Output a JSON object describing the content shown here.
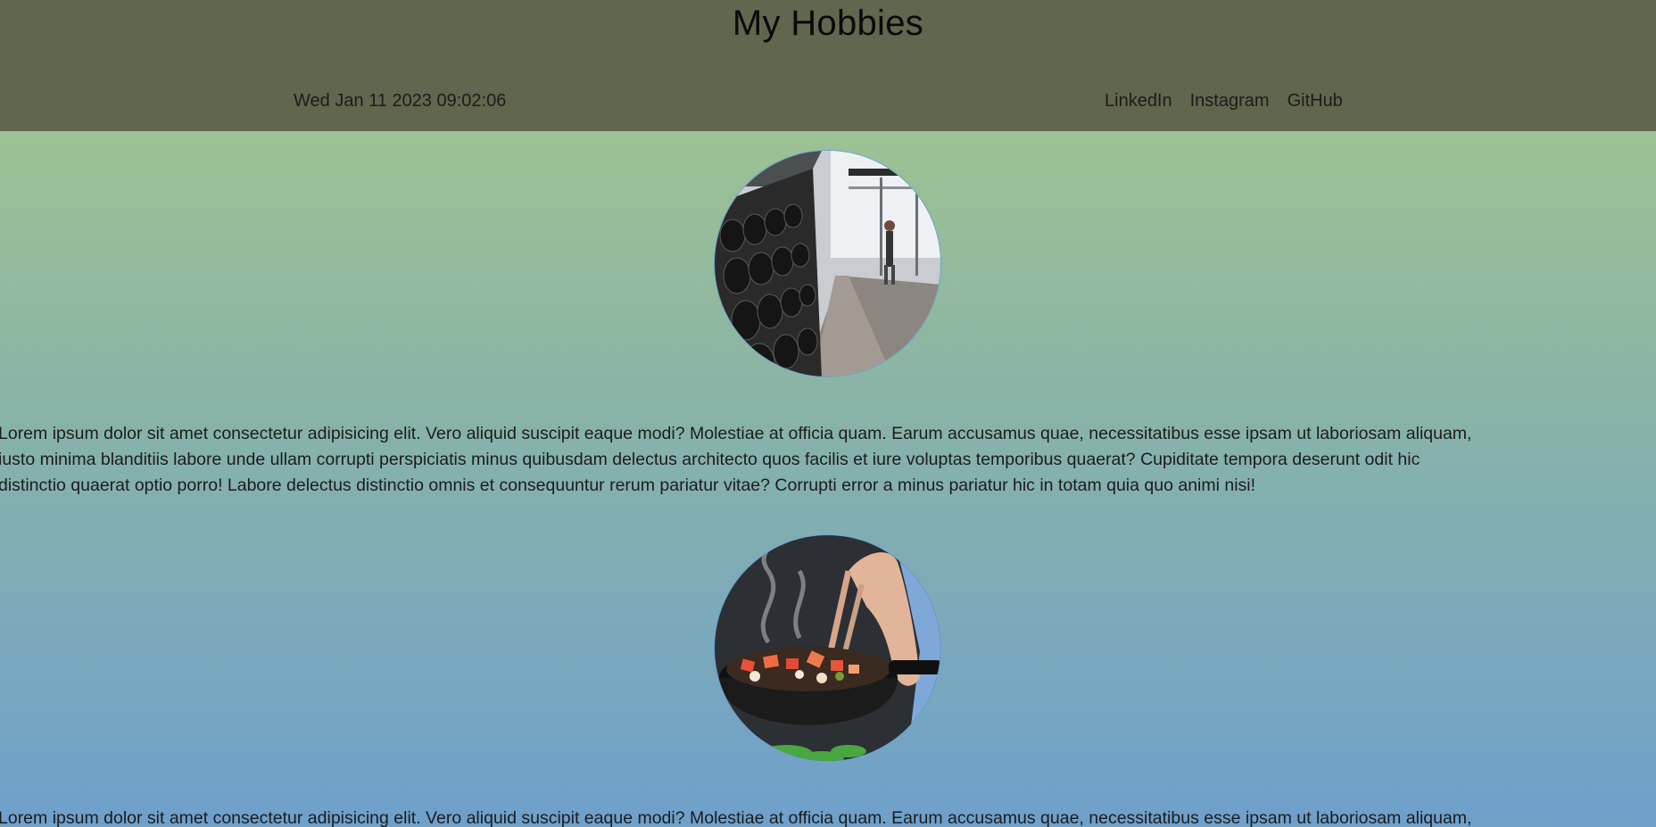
{
  "header": {
    "title": "My Hobbies",
    "datetime": "Wed Jan 11 2023 09:02:06",
    "links": [
      {
        "label": "LinkedIn"
      },
      {
        "label": "Instagram"
      },
      {
        "label": "GitHub"
      }
    ]
  },
  "hobbies": [
    {
      "image_alt": "gym dumbbell rack",
      "text": "Lorem ipsum dolor sit amet consectetur adipisicing elit. Vero aliquid suscipit eaque modi? Molestiae at officia quam. Earum accusamus quae, necessitatibus esse ipsam ut laboriosam aliquam,\niusto minima blanditiis labore unde ullam corrupti perspiciatis minus quibusdam delectus architecto quos facilis et iure voluptas temporibus quaerat? Cupiditate tempora deserunt odit hic\ndistinctio quaerat optio porro! Labore delectus distinctio omnis et consequuntur rerum pariatur vitae? Corrupti error a minus pariatur hic in totam quia quo animi nisi!"
    },
    {
      "image_alt": "cooking vegetables in a pan",
      "text": "Lorem ipsum dolor sit amet consectetur adipisicing elit. Vero aliquid suscipit eaque modi? Molestiae at officia quam. Earum accusamus quae, necessitatibus esse ipsam ut laboriosam aliquam,"
    }
  ],
  "colors": {
    "header_bg": "#61664e",
    "gradient_top": "#a6c88a",
    "gradient_bottom": "#6ea0cb"
  }
}
